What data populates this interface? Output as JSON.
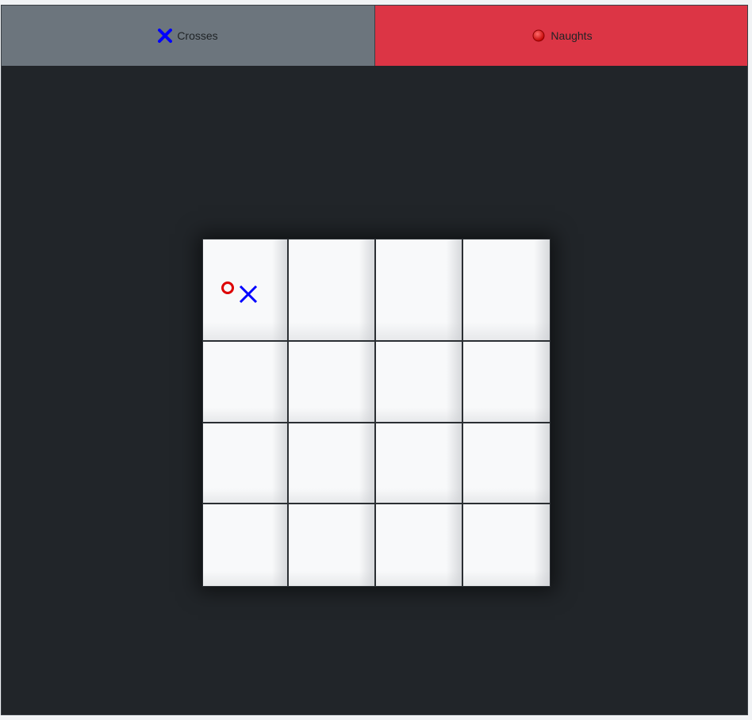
{
  "players": {
    "crosses": {
      "label": "Crosses",
      "icon": "cross-icon",
      "color": "#0000ff",
      "tab_color": "#6c757d"
    },
    "naughts": {
      "label": "Naughts",
      "icon": "circle-icon",
      "color": "#dd0000",
      "tab_color": "#dc3545"
    }
  },
  "board": {
    "rows": 4,
    "cols": 4,
    "cells": [
      [
        [
          "O",
          "X"
        ],
        [],
        [],
        []
      ],
      [
        [],
        [],
        [],
        []
      ],
      [
        [],
        [],
        [],
        []
      ],
      [
        [],
        [],
        [],
        []
      ]
    ]
  },
  "colors": {
    "background": "#212529",
    "cell": "#f8f9fa",
    "grid_line": "#2b2f33"
  }
}
